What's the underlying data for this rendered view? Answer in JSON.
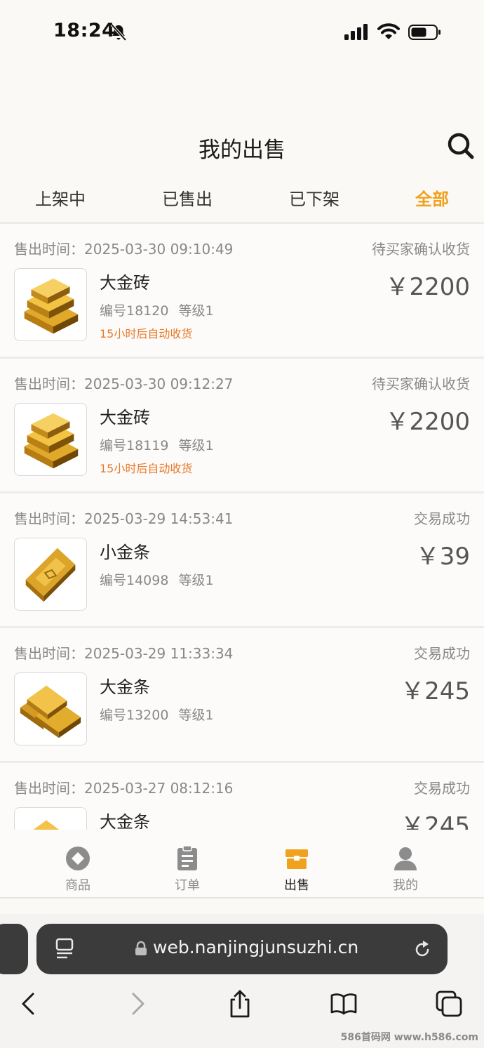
{
  "status_bar": {
    "time": "18:24"
  },
  "header": {
    "title": "我的出售"
  },
  "tabs": [
    {
      "label": "上架中"
    },
    {
      "label": "已售出"
    },
    {
      "label": "已下架"
    },
    {
      "label": "全部",
      "active": true
    }
  ],
  "orders": [
    {
      "time": "售出时间：2025-03-30 09:10:49",
      "status": "待买家确认收货",
      "name": "大金砖",
      "serial": "编号18120",
      "level": "等级1",
      "note": "15小时后自动收货",
      "price": "￥2200",
      "image": "gold-brick-stack"
    },
    {
      "time": "售出时间：2025-03-30 09:12:27",
      "status": "待买家确认收货",
      "name": "大金砖",
      "serial": "编号18119",
      "level": "等级1",
      "note": "15小时后自动收货",
      "price": "￥2200",
      "image": "gold-brick-stack"
    },
    {
      "time": "售出时间：2025-03-29 14:53:41",
      "status": "交易成功",
      "name": "小金条",
      "serial": "编号14098",
      "level": "等级1",
      "note": "",
      "price": "￥39",
      "image": "single-gold-bar"
    },
    {
      "time": "售出时间：2025-03-29 11:33:34",
      "status": "交易成功",
      "name": "大金条",
      "serial": "编号13200",
      "level": "等级1",
      "note": "",
      "price": "￥245",
      "image": "gold-bar-pile"
    },
    {
      "time": "售出时间：2025-03-27 08:12:16",
      "status": "交易成功",
      "name": "大金条",
      "serial": "",
      "level": "",
      "note": "",
      "price": "￥245",
      "image": "gold-bar-pile"
    }
  ],
  "bottom_nav": [
    {
      "label": "商品",
      "icon": "goods-icon"
    },
    {
      "label": "订单",
      "icon": "orders-icon"
    },
    {
      "label": "出售",
      "icon": "sell-icon",
      "active": true
    },
    {
      "label": "我的",
      "icon": "profile-icon"
    }
  ],
  "browser": {
    "url": "web.nanjingjunsuzhi.cn"
  },
  "watermark": "586首码网 www.h586.com",
  "colors": {
    "accent": "#f0a21e",
    "note": "#e8792a",
    "muted": "#888888"
  }
}
